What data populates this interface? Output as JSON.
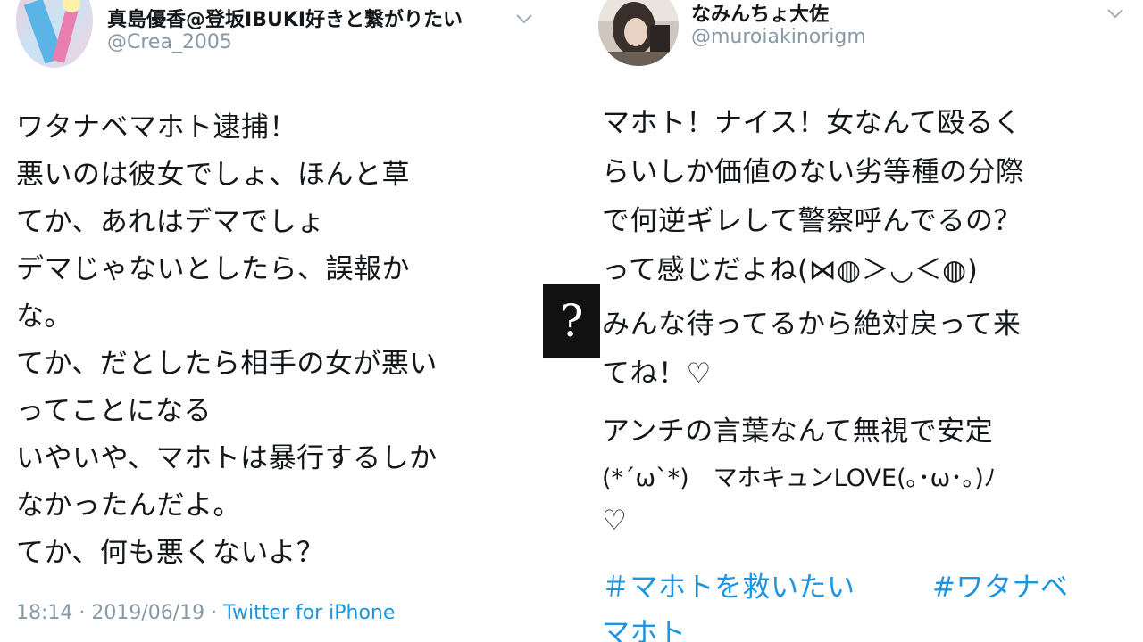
{
  "left_tweet": {
    "display_name": "真島優香@登坂IBUKI好きと繋がりたい",
    "handle": "@Crea_2005",
    "lines": [
      "ワタナベマホト逮捕！",
      "悪いのは彼女でしょ、ほんと草",
      "てか、あれはデマでしょ",
      "デマじゃないとしたら、誤報か",
      "な。",
      "てか、だとしたら相手の女が悪い",
      "ってことになる",
      "いやいや、マホトは暴行するしか",
      "なかったんだよ。",
      "てか、何も悪くないよ？"
    ],
    "time": "18:14 · 2019/06/19 · ",
    "source": "Twitter for iPhone"
  },
  "right_tweet": {
    "display_name": "なみんちょ大佐",
    "handle": "@muroiakinorigm",
    "lines": [
      "マホト！ナイス！女なんて殴るく",
      "らいしか価値のない劣等種の分際",
      "で何逆ギレして警察呼んでるの？",
      "って感じだよね(⋈◍＞◡＜◍)",
      "みんな待ってるから絶対戻って来",
      "てね！♡",
      "アンチの言葉なんて無視で安定",
      "(*ˊωˋ*)　マホキュンLOVE(｡･ω･｡)ﾉ",
      "♡"
    ],
    "hashtags": [
      "＃マホトを救いたい",
      "#ワタナベ",
      "マホト"
    ]
  },
  "overlay": {
    "symbol": "?"
  },
  "colors": {
    "link": "#1b95e0",
    "muted": "#8899a6",
    "text": "#14171a"
  }
}
